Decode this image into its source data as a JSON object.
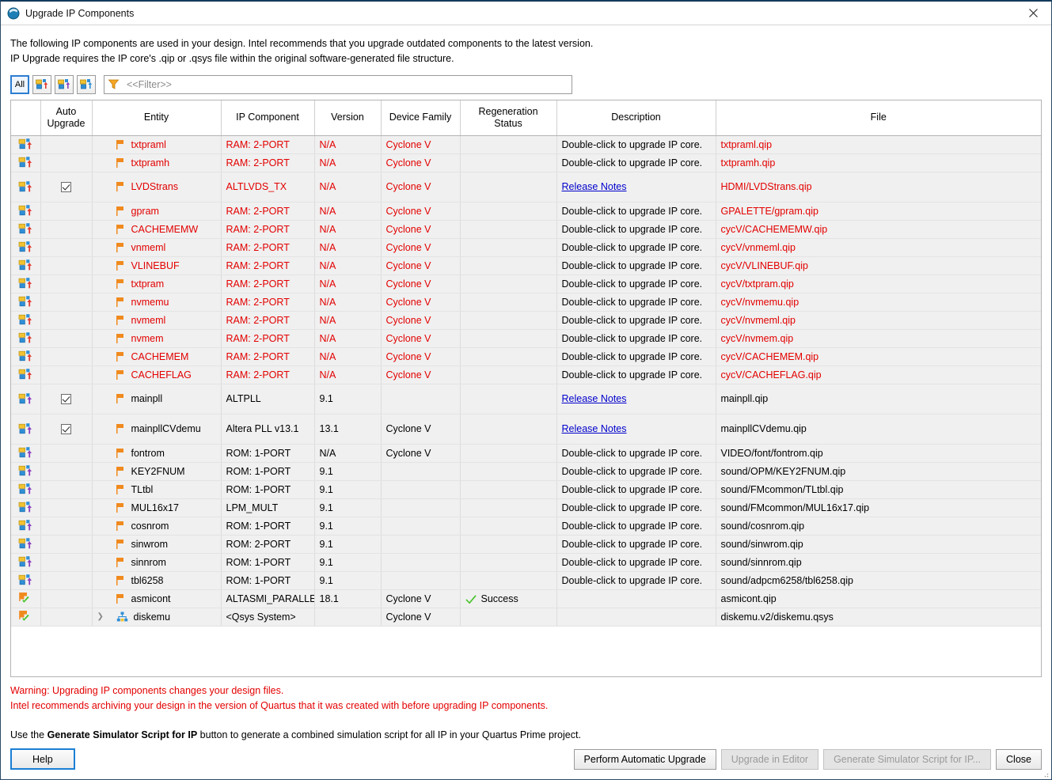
{
  "window": {
    "title": "Upgrade IP Components",
    "app_icon": "quartus-sphere-icon",
    "close_label": "✕"
  },
  "intro": {
    "line1": "The following IP components are used in your design. Intel recommends that you upgrade outdated components to the latest version.",
    "line2": "IP Upgrade requires the IP core's .qip or .qsys file within the original software-generated file structure."
  },
  "toolbar": {
    "all_label": "All",
    "buttons": [
      {
        "name": "filter-all-button",
        "label": "All",
        "active": true
      },
      {
        "name": "filter-outdated-button",
        "label": "",
        "active": false
      },
      {
        "name": "filter-upgradable-button",
        "label": "",
        "active": false
      },
      {
        "name": "filter-editable-button",
        "label": "",
        "active": false
      }
    ],
    "filter_placeholder": "<<Filter>>",
    "filter_value": ""
  },
  "table": {
    "columns": [
      {
        "key": "status",
        "label": ""
      },
      {
        "key": "auto",
        "label": "Auto\nUpgrade"
      },
      {
        "key": "entity",
        "label": "Entity"
      },
      {
        "key": "ip_component",
        "label": "IP Component"
      },
      {
        "key": "version",
        "label": "Version"
      },
      {
        "key": "device_family",
        "label": "Device Family"
      },
      {
        "key": "regen",
        "label": "Regeneration\nStatus"
      },
      {
        "key": "description",
        "label": "Description"
      },
      {
        "key": "file",
        "label": "File"
      }
    ],
    "header_labels": {
      "auto_line1": "Auto",
      "auto_line2": "Upgrade",
      "entity": "Entity",
      "ip_component": "IP Component",
      "version": "Version",
      "device_family": "Device Family",
      "regen_line1": "Regeneration",
      "regen_line2": "Status",
      "description": "Description",
      "file": "File"
    },
    "descriptions": {
      "double_click": "Double-click to upgrade IP core.",
      "release_notes": "Release Notes"
    },
    "rows": [
      {
        "status_icon": "upgrade-required-icon",
        "auto": false,
        "entity": "txtpraml",
        "ip_component": "RAM: 2-PORT",
        "version": "N/A",
        "device_family": "Cyclone V",
        "regen": "",
        "description": "Double-click to upgrade IP core.",
        "desc_is_link": false,
        "file": "txtpraml.qip",
        "state": "outdated",
        "tall": false
      },
      {
        "status_icon": "upgrade-required-icon",
        "auto": false,
        "entity": "txtpramh",
        "ip_component": "RAM: 2-PORT",
        "version": "N/A",
        "device_family": "Cyclone V",
        "regen": "",
        "description": "Double-click to upgrade IP core.",
        "desc_is_link": false,
        "file": "txtpramh.qip",
        "state": "outdated",
        "tall": false
      },
      {
        "status_icon": "upgrade-required-icon",
        "auto": true,
        "entity": "LVDStrans",
        "ip_component": "ALTLVDS_TX",
        "version": "N/A",
        "device_family": "Cyclone V",
        "regen": "",
        "description": "Release Notes",
        "desc_is_link": true,
        "file": "HDMI/LVDStrans.qip",
        "state": "outdated",
        "tall": true
      },
      {
        "status_icon": "upgrade-required-icon",
        "auto": false,
        "entity": "gpram",
        "ip_component": "RAM: 2-PORT",
        "version": "N/A",
        "device_family": "Cyclone V",
        "regen": "",
        "description": "Double-click to upgrade IP core.",
        "desc_is_link": false,
        "file": "GPALETTE/gpram.qip",
        "state": "outdated",
        "tall": false
      },
      {
        "status_icon": "upgrade-required-icon",
        "auto": false,
        "entity": "CACHEMEMW",
        "ip_component": "RAM: 2-PORT",
        "version": "N/A",
        "device_family": "Cyclone V",
        "regen": "",
        "description": "Double-click to upgrade IP core.",
        "desc_is_link": false,
        "file": "cycV/CACHEMEMW.qip",
        "state": "outdated",
        "tall": false
      },
      {
        "status_icon": "upgrade-required-icon",
        "auto": false,
        "entity": "vnmeml",
        "ip_component": "RAM: 2-PORT",
        "version": "N/A",
        "device_family": "Cyclone V",
        "regen": "",
        "description": "Double-click to upgrade IP core.",
        "desc_is_link": false,
        "file": "cycV/vnmeml.qip",
        "state": "outdated",
        "tall": false
      },
      {
        "status_icon": "upgrade-required-icon",
        "auto": false,
        "entity": "VLINEBUF",
        "ip_component": "RAM: 2-PORT",
        "version": "N/A",
        "device_family": "Cyclone V",
        "regen": "",
        "description": "Double-click to upgrade IP core.",
        "desc_is_link": false,
        "file": "cycV/VLINEBUF.qip",
        "state": "outdated",
        "tall": false
      },
      {
        "status_icon": "upgrade-required-icon",
        "auto": false,
        "entity": "txtpram",
        "ip_component": "RAM: 2-PORT",
        "version": "N/A",
        "device_family": "Cyclone V",
        "regen": "",
        "description": "Double-click to upgrade IP core.",
        "desc_is_link": false,
        "file": "cycV/txtpram.qip",
        "state": "outdated",
        "tall": false
      },
      {
        "status_icon": "upgrade-required-icon",
        "auto": false,
        "entity": "nvmemu",
        "ip_component": "RAM: 2-PORT",
        "version": "N/A",
        "device_family": "Cyclone V",
        "regen": "",
        "description": "Double-click to upgrade IP core.",
        "desc_is_link": false,
        "file": "cycV/nvmemu.qip",
        "state": "outdated",
        "tall": false
      },
      {
        "status_icon": "upgrade-required-icon",
        "auto": false,
        "entity": "nvmeml",
        "ip_component": "RAM: 2-PORT",
        "version": "N/A",
        "device_family": "Cyclone V",
        "regen": "",
        "description": "Double-click to upgrade IP core.",
        "desc_is_link": false,
        "file": "cycV/nvmeml.qip",
        "state": "outdated",
        "tall": false
      },
      {
        "status_icon": "upgrade-required-icon",
        "auto": false,
        "entity": "nvmem",
        "ip_component": "RAM: 2-PORT",
        "version": "N/A",
        "device_family": "Cyclone V",
        "regen": "",
        "description": "Double-click to upgrade IP core.",
        "desc_is_link": false,
        "file": "cycV/nvmem.qip",
        "state": "outdated",
        "tall": false
      },
      {
        "status_icon": "upgrade-required-icon",
        "auto": false,
        "entity": "CACHEMEM",
        "ip_component": "RAM: 2-PORT",
        "version": "N/A",
        "device_family": "Cyclone V",
        "regen": "",
        "description": "Double-click to upgrade IP core.",
        "desc_is_link": false,
        "file": "cycV/CACHEMEM.qip",
        "state": "outdated",
        "tall": false
      },
      {
        "status_icon": "upgrade-required-icon",
        "auto": false,
        "entity": "CACHEFLAG",
        "ip_component": "RAM: 2-PORT",
        "version": "N/A",
        "device_family": "Cyclone V",
        "regen": "",
        "description": "Double-click to upgrade IP core.",
        "desc_is_link": false,
        "file": "cycV/CACHEFLAG.qip",
        "state": "outdated",
        "tall": false
      },
      {
        "status_icon": "upgrade-available-icon",
        "auto": true,
        "entity": "mainpll",
        "ip_component": "ALTPLL",
        "version": "9.1",
        "device_family": "",
        "regen": "",
        "description": "Release Notes",
        "desc_is_link": true,
        "file": "mainpll.qip",
        "state": "normal",
        "tall": true
      },
      {
        "status_icon": "upgrade-available-icon",
        "auto": true,
        "entity": "mainpllCVdemu",
        "ip_component": "Altera PLL v13.1",
        "version": "13.1",
        "device_family": "Cyclone V",
        "regen": "",
        "description": "Release Notes",
        "desc_is_link": true,
        "file": "mainpllCVdemu.qip",
        "state": "normal",
        "tall": true
      },
      {
        "status_icon": "upgrade-available-icon",
        "auto": false,
        "entity": "fontrom",
        "ip_component": "ROM: 1-PORT",
        "version": "N/A",
        "device_family": "Cyclone V",
        "regen": "",
        "description": "Double-click to upgrade IP core.",
        "desc_is_link": false,
        "file": "VIDEO/font/fontrom.qip",
        "state": "normal",
        "tall": false
      },
      {
        "status_icon": "upgrade-available-icon",
        "auto": false,
        "entity": "KEY2FNUM",
        "ip_component": "ROM: 1-PORT",
        "version": "9.1",
        "device_family": "",
        "regen": "",
        "description": "Double-click to upgrade IP core.",
        "desc_is_link": false,
        "file": "sound/OPM/KEY2FNUM.qip",
        "state": "normal",
        "tall": false
      },
      {
        "status_icon": "upgrade-available-icon",
        "auto": false,
        "entity": "TLtbl",
        "ip_component": "ROM: 1-PORT",
        "version": "9.1",
        "device_family": "",
        "regen": "",
        "description": "Double-click to upgrade IP core.",
        "desc_is_link": false,
        "file": "sound/FMcommon/TLtbl.qip",
        "state": "normal",
        "tall": false
      },
      {
        "status_icon": "upgrade-available-icon",
        "auto": false,
        "entity": "MUL16x17",
        "ip_component": "LPM_MULT",
        "version": "9.1",
        "device_family": "",
        "regen": "",
        "description": "Double-click to upgrade IP core.",
        "desc_is_link": false,
        "file": "sound/FMcommon/MUL16x17.qip",
        "state": "normal",
        "tall": false
      },
      {
        "status_icon": "upgrade-available-icon",
        "auto": false,
        "entity": "cosnrom",
        "ip_component": "ROM: 1-PORT",
        "version": "9.1",
        "device_family": "",
        "regen": "",
        "description": "Double-click to upgrade IP core.",
        "desc_is_link": false,
        "file": "sound/cosnrom.qip",
        "state": "normal",
        "tall": false
      },
      {
        "status_icon": "upgrade-available-icon",
        "auto": false,
        "entity": "sinwrom",
        "ip_component": "ROM: 2-PORT",
        "version": "9.1",
        "device_family": "",
        "regen": "",
        "description": "Double-click to upgrade IP core.",
        "desc_is_link": false,
        "file": "sound/sinwrom.qip",
        "state": "normal",
        "tall": false
      },
      {
        "status_icon": "upgrade-available-icon",
        "auto": false,
        "entity": "sinnrom",
        "ip_component": "ROM: 1-PORT",
        "version": "9.1",
        "device_family": "",
        "regen": "",
        "description": "Double-click to upgrade IP core.",
        "desc_is_link": false,
        "file": "sound/sinnrom.qip",
        "state": "normal",
        "tall": false
      },
      {
        "status_icon": "upgrade-available-icon",
        "auto": false,
        "entity": "tbl6258",
        "ip_component": "ROM: 1-PORT",
        "version": "9.1",
        "device_family": "",
        "regen": "",
        "description": "Double-click to upgrade IP core.",
        "desc_is_link": false,
        "file": "sound/adpcm6258/tbl6258.qip",
        "state": "normal",
        "tall": false
      },
      {
        "status_icon": "up-to-date-icon",
        "auto": false,
        "entity": "asmicont",
        "ip_component": "ALTASMI_PARALLEL",
        "version": "18.1",
        "device_family": "Cyclone V",
        "regen": "Success",
        "description": "",
        "desc_is_link": false,
        "file": "asmicont.qip",
        "state": "normal",
        "tall": false
      },
      {
        "status_icon": "up-to-date-icon",
        "auto": false,
        "entity": "diskemu",
        "ip_component": "<Qsys System>",
        "version": "",
        "device_family": "Cyclone V",
        "regen": "",
        "description": "",
        "desc_is_link": false,
        "file": "diskemu.v2/diskemu.qsys",
        "state": "normal",
        "tall": false,
        "expandable": true,
        "entity_icon": "qsys-system-icon"
      }
    ]
  },
  "warnings": {
    "line1": "Warning: Upgrading IP components changes your design files.",
    "line2": "Intel recommends archiving your design in the version of Quartus that it was created with before upgrading IP components."
  },
  "hint": {
    "prefix": "Use the ",
    "bold": "Generate Simulator Script for IP",
    "suffix": " button to generate a combined simulation script for all IP in your Quartus Prime project."
  },
  "buttons": {
    "help": "Help",
    "perform_automatic_upgrade": "Perform Automatic Upgrade",
    "upgrade_in_editor": "Upgrade in Editor",
    "generate_simulator_script": "Generate Simulator Script for IP...",
    "close": "Close"
  },
  "colors": {
    "error_red": "#e30000",
    "link_blue": "#0000cc",
    "accent_blue": "#1b7fd4",
    "row_bg": "#f0f0f0",
    "success_green": "#2aa22a"
  }
}
